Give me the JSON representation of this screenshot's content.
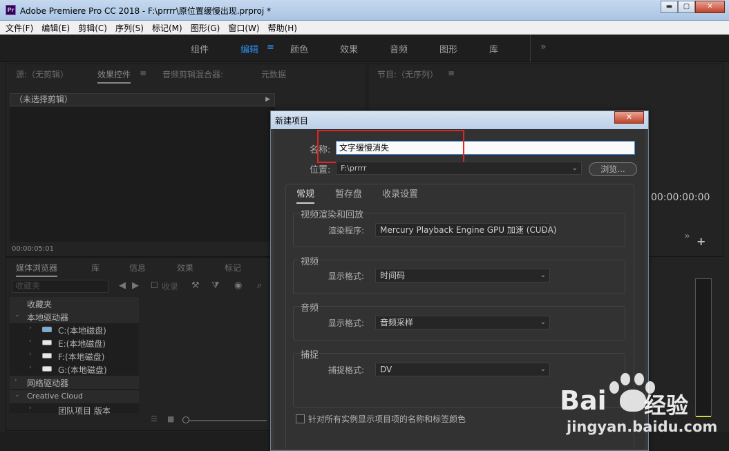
{
  "window": {
    "icon_text": "Pr",
    "title": "Adobe Premiere Pro CC 2018 - F:\\prrrr\\原位置缓慢出现.prproj *",
    "min_glyph": "▬",
    "max_glyph": "▢",
    "close_glyph": "✕"
  },
  "menubar": [
    "文件(F)",
    "编辑(E)",
    "剪辑(C)",
    "序列(S)",
    "标记(M)",
    "图形(G)",
    "窗口(W)",
    "帮助(H)"
  ],
  "workspace": {
    "tabs": [
      "组件",
      "编辑",
      "颜色",
      "效果",
      "音频",
      "图形",
      "库"
    ],
    "active_tab": "编辑",
    "menu_glyph": "≡",
    "more_glyph": "»"
  },
  "source_panel": {
    "tabs": [
      "源:（无剪辑）",
      "效果控件",
      "音频剪辑混合器:",
      "元数据"
    ],
    "active_tab": "效果控件",
    "clip_label": "（未选择剪辑）",
    "timecode": "00:00:05:01"
  },
  "program_panel": {
    "tab": "节目:（无序列）",
    "timecode": "00:00:00:00"
  },
  "media_browser": {
    "tabs": [
      "媒体浏览器",
      "库",
      "信息",
      "效果",
      "标记"
    ],
    "favorites_select": "收藏夹",
    "ingest_label": "收录",
    "tree": {
      "favorites": "收藏夹",
      "local_drives": "本地驱动器",
      "drives": [
        "C:(本地磁盘)",
        "E:(本地磁盘)",
        "F:(本地磁盘)",
        "G:(本地磁盘)"
      ],
      "network_drives": "网络驱动器",
      "creative_cloud": "Creative Cloud",
      "team_projects": "团队项目 版本"
    }
  },
  "dialog": {
    "title": "新建项目",
    "close_glyph": "✕",
    "name_label": "名称:",
    "name_value": "文字缓慢消失",
    "location_label": "位置:",
    "location_value": "F:\\prrrr",
    "browse_label": "浏览...",
    "tabs": [
      "常规",
      "暂存盘",
      "收录设置"
    ],
    "active_tab": "常规",
    "groups": {
      "render": {
        "title": "视频渲染和回放",
        "field_label": "渲染程序:",
        "field_value": "Mercury Playback Engine GPU 加速 (CUDA)"
      },
      "video": {
        "title": "视频",
        "field_label": "显示格式:",
        "field_value": "时间码"
      },
      "audio": {
        "title": "音频",
        "field_label": "显示格式:",
        "field_value": "音频采样"
      },
      "capture": {
        "title": "捕捉",
        "field_label": "捕捉格式:",
        "field_value": "DV"
      }
    },
    "checkbox_label": "针对所有实例显示项目项的名称和标签颜色",
    "highlight_color": "#e12424"
  },
  "watermark": {
    "brand": "Bai",
    "brand_suffix": "经验",
    "url": "jingyan.baidu.com"
  },
  "colors": {
    "accent": "#2d8ceb",
    "panel_bg": "#232323",
    "dialog_bg": "#323232"
  }
}
